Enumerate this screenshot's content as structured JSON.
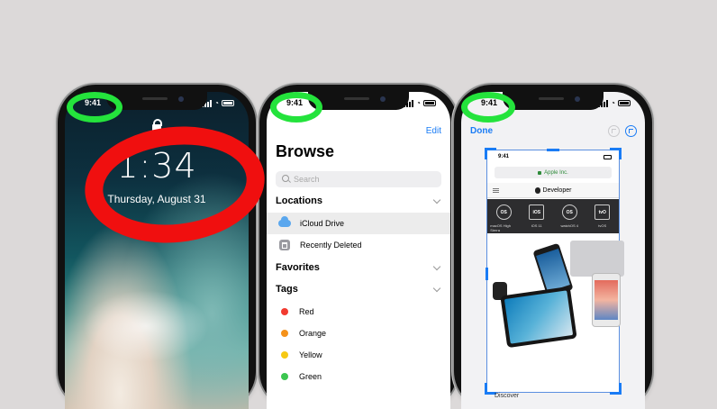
{
  "phones": [
    {
      "status_time": "9:41",
      "lock_time": "1:34",
      "lock_date": "Thursday, August 31"
    },
    {
      "status_time": "9:41",
      "edit_label": "Edit",
      "title": "Browse",
      "search_placeholder": "Search",
      "sections": {
        "locations": "Locations",
        "favorites": "Favorites",
        "tags": "Tags"
      },
      "locations": [
        "iCloud Drive",
        "Recently Deleted"
      ],
      "tags": [
        {
          "label": "Red",
          "color": "#f23b30"
        },
        {
          "label": "Orange",
          "color": "#f5921b"
        },
        {
          "label": "Yellow",
          "color": "#f6c913"
        },
        {
          "label": "Green",
          "color": "#3cc650"
        }
      ]
    },
    {
      "status_time": "9:41",
      "done_label": "Done",
      "screenshot": {
        "time": "9:41",
        "url": "Apple Inc.",
        "site_title": "Developer",
        "platforms": [
          {
            "badge": "OS",
            "label": "macOS High Sierra"
          },
          {
            "badge": "iOS",
            "label": "iOS 11"
          },
          {
            "badge": "OS",
            "label": "watchOS 4"
          },
          {
            "badge": "tvO",
            "label": "tvOS"
          }
        ],
        "footer": "Discover"
      }
    }
  ],
  "annotations": {
    "green_color": "#24e33c",
    "red_color": "#f00f0f"
  }
}
